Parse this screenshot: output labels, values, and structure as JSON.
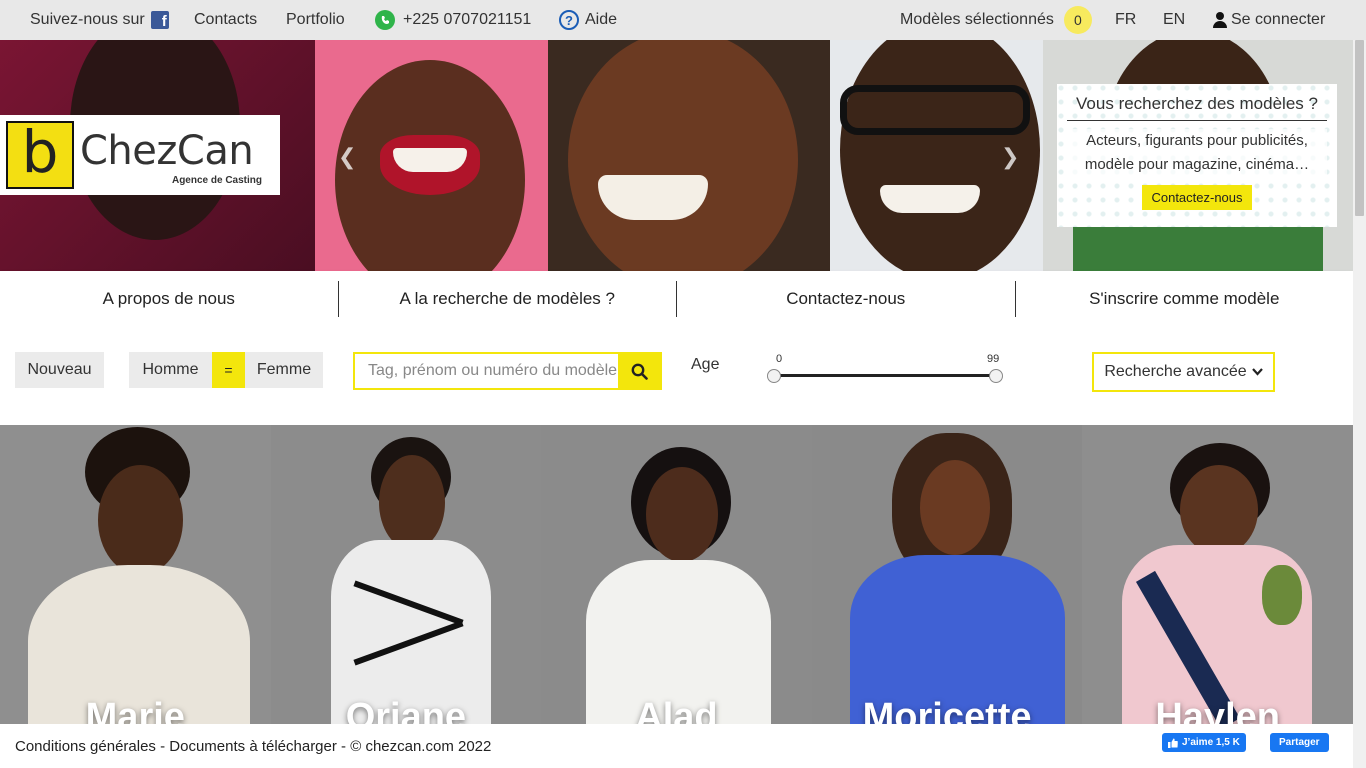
{
  "topbar": {
    "follow_label": "Suivez-nous sur",
    "contacts": "Contacts",
    "portfolio": "Portfolio",
    "phone": "+225 0707021151",
    "help": "Aide",
    "selected_models_label": "Modèles sélectionnés",
    "selected_count": "0",
    "lang_fr": "FR",
    "lang_en": "EN",
    "login": "Se connecter"
  },
  "logo": {
    "brand_letter": "b",
    "name": "ChezCan",
    "tagline": "Agence de Casting"
  },
  "hero": {
    "prev_icon": "chevron-left-icon",
    "next_icon": "chevron-right-icon",
    "promo_title": "Vous recherchez des modèles ?",
    "promo_text": "Acteurs, figurants pour publicités, modèle pour magazine, cinéma…",
    "promo_button": "Contactez-nous"
  },
  "nav": {
    "items": [
      "A propos de nous",
      "A la recherche de modèles ?",
      "Contactez-nous",
      "S'inscrire comme modèle"
    ]
  },
  "filters": {
    "new_label": "Nouveau",
    "male_label": "Homme",
    "equal_label": "=",
    "female_label": "Femme",
    "search_placeholder": "Tag, prénom ou numéro du modèle",
    "age_label": "Age",
    "age_min": "0",
    "age_max": "99",
    "advanced_label": "Recherche avancée"
  },
  "models": [
    {
      "name": "Marie"
    },
    {
      "name": "Oriane"
    },
    {
      "name": "Alad"
    },
    {
      "name": "Moricette"
    },
    {
      "name": "Haylen"
    }
  ],
  "footer": {
    "conditions": "Conditions générales",
    "documents": "Documents à télécharger",
    "copyright": "© chezcan.com 2022",
    "separator": " - ",
    "like_label": "J’aime 1,5 K",
    "share_label": "Partager"
  },
  "colors": {
    "accent": "#f3e60c",
    "topbar_bg": "#e8e8e8",
    "facebook": "#1877f2"
  }
}
